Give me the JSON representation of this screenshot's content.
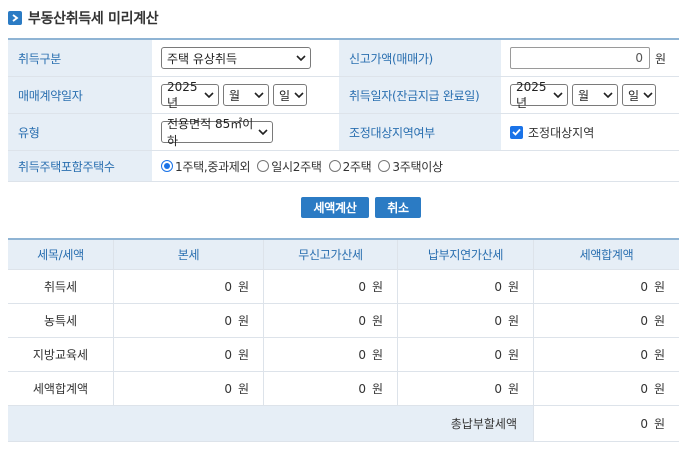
{
  "header": {
    "title": "부동산취득세 미리계산",
    "icon": "chevron-right-icon",
    "accent": "#2b7bc4"
  },
  "form": {
    "acq_type": {
      "label": "취득구분",
      "selected": "주택 유상취득"
    },
    "report_price": {
      "label": "신고가액(매매가)",
      "value": "0",
      "unit": "원"
    },
    "contract_date": {
      "label": "매매계약일자",
      "year": "2025년",
      "month": "월",
      "day": "일"
    },
    "acq_date": {
      "label": "취득일자(잔금지급 완료일)",
      "year": "2025년",
      "month": "월",
      "day": "일"
    },
    "type": {
      "label": "유형",
      "selected": "전용면적 85㎡이하"
    },
    "adjust_area": {
      "label": "조정대상지역여부",
      "checkbox_label": "조정대상지역",
      "checked": true
    },
    "house_count": {
      "label": "취득주택포함주택수",
      "options": [
        "1주택,중과제외",
        "일시2주택",
        "2주택",
        "3주택이상"
      ],
      "selected_index": 0
    }
  },
  "buttons": {
    "calc": "세액계산",
    "cancel": "취소"
  },
  "result": {
    "headers": [
      "세목/세액",
      "본세",
      "무신고가산세",
      "납부지연가산세",
      "세액합계액"
    ],
    "rows": [
      {
        "name": "취득세",
        "values": [
          "0",
          "0",
          "0",
          "0"
        ]
      },
      {
        "name": "농특세",
        "values": [
          "0",
          "0",
          "0",
          "0"
        ]
      },
      {
        "name": "지방교육세",
        "values": [
          "0",
          "0",
          "0",
          "0"
        ]
      },
      {
        "name": "세액합계액",
        "values": [
          "0",
          "0",
          "0",
          "0"
        ]
      }
    ],
    "unit": "원",
    "total_label": "총납부할세액",
    "total_value": "0"
  }
}
